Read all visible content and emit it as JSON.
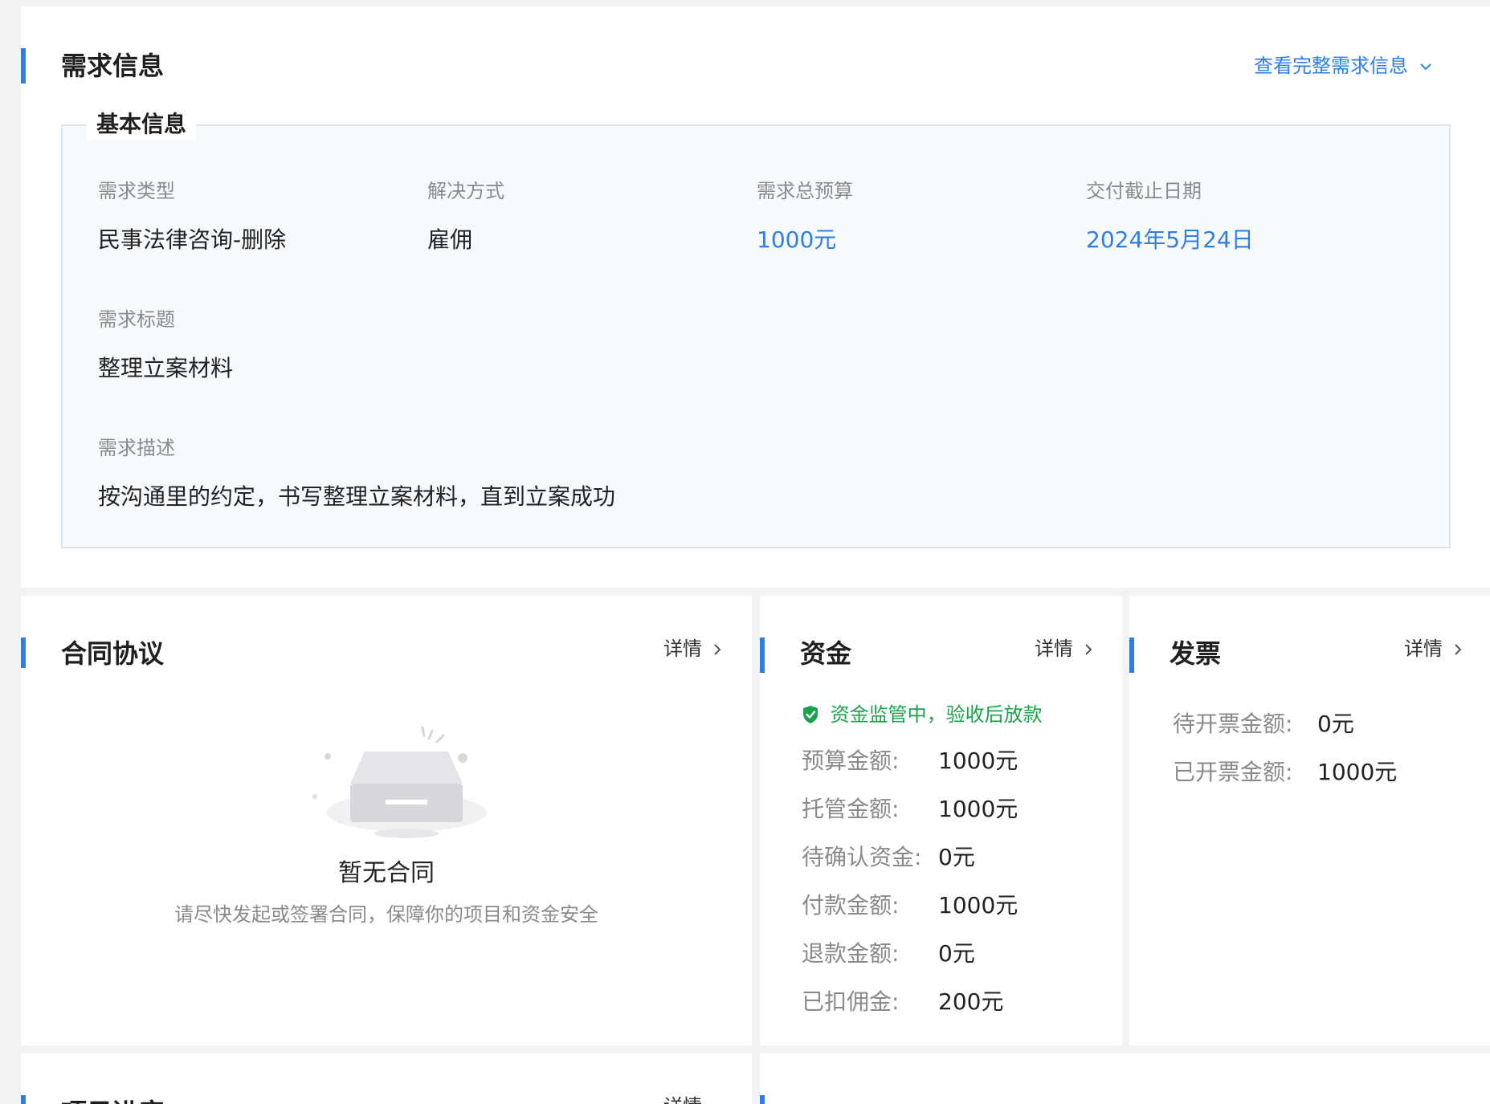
{
  "requirement": {
    "title": "需求信息",
    "view_full_link": "查看完整需求信息",
    "basic_info": {
      "legend": "基本信息",
      "fields": [
        {
          "label": "需求类型",
          "value": "民事法律咨询-删除"
        },
        {
          "label": "解决方式",
          "value": "雇佣"
        },
        {
          "label": "需求总预算",
          "value": "1000元"
        },
        {
          "label": "交付截止日期",
          "value": "2024年5月24日"
        }
      ],
      "title_label": "需求标题",
      "title_value": "整理立案材料",
      "desc_label": "需求描述",
      "desc_value": "按沟通里的约定，书写整理立案材料，直到立案成功"
    }
  },
  "contract": {
    "title": "合同协议",
    "details_link": "详情",
    "empty_title": "暂无合同",
    "empty_subtitle": "请尽快发起或签署合同，保障你的项目和资金安全"
  },
  "funds": {
    "title": "资金",
    "details_link": "详情",
    "notice": "资金监管中，验收后放款",
    "rows": [
      {
        "label": "预算金额:",
        "value": "1000元"
      },
      {
        "label": "托管金额:",
        "value": "1000元"
      },
      {
        "label": "待确认资金:",
        "value": "0元"
      },
      {
        "label": "付款金额:",
        "value": "1000元"
      },
      {
        "label": "退款金额:",
        "value": "0元"
      },
      {
        "label": "已扣佣金:",
        "value": "200元"
      }
    ]
  },
  "invoice": {
    "title": "发票",
    "details_link": "详情",
    "rows": [
      {
        "label": "待开票金额:",
        "value": "0元"
      },
      {
        "label": "已开票金额:",
        "value": "1000元"
      }
    ]
  },
  "progress": {
    "title": "项目进度",
    "details_link": "详情"
  },
  "colors": {
    "accent": "#2f7ee8",
    "success": "#1aa34a",
    "muted": "#8a8a8a"
  }
}
